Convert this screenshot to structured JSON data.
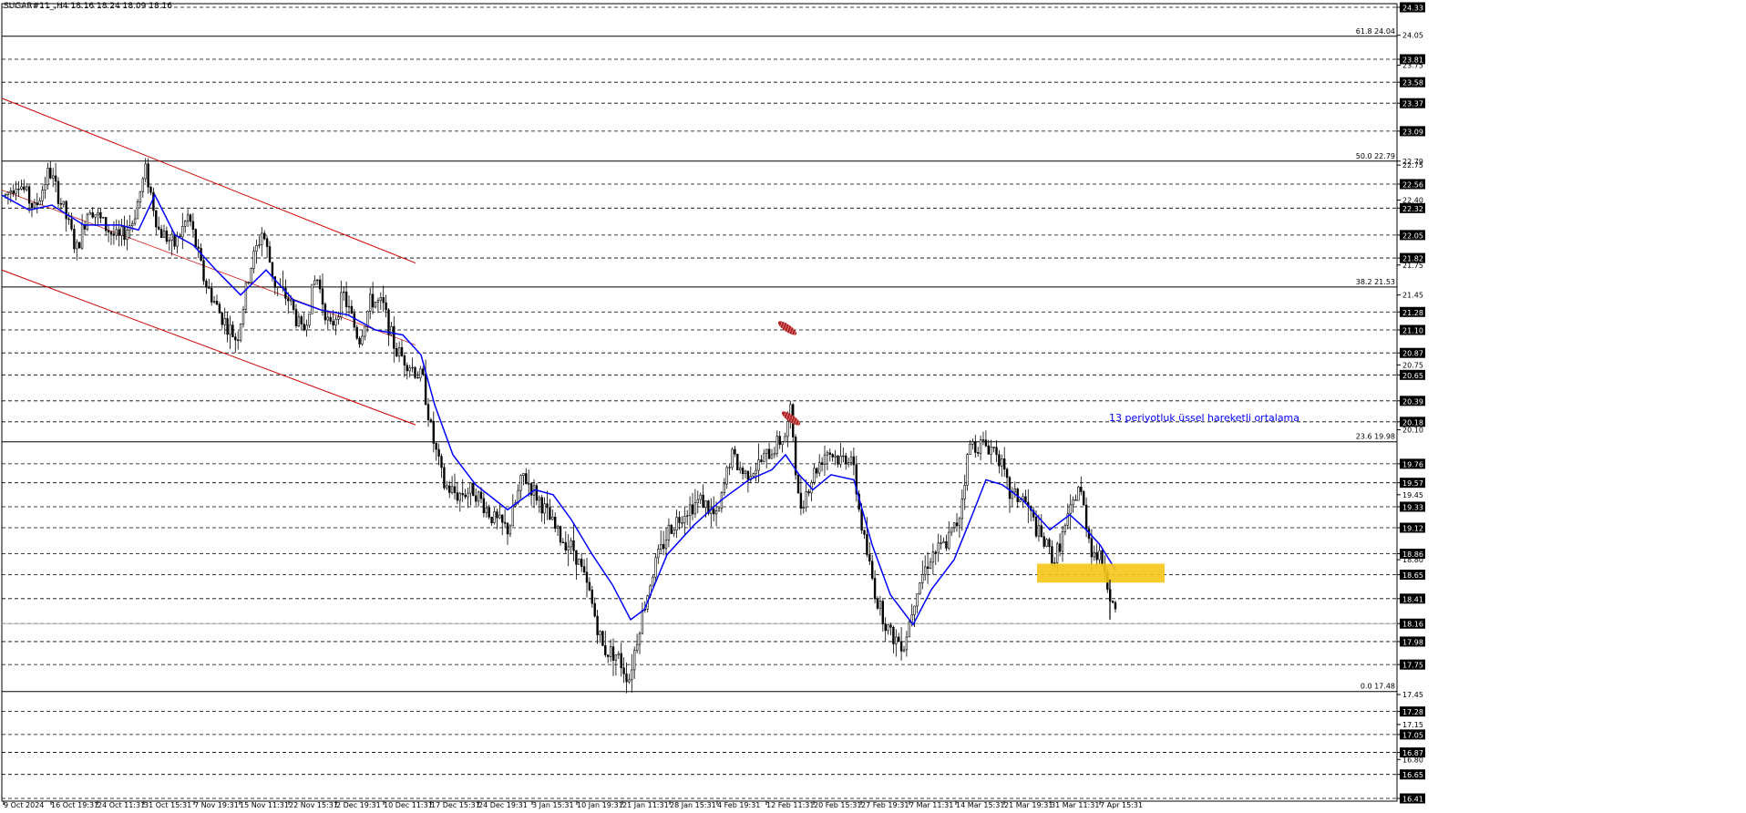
{
  "header": {
    "title": "SUGAR#11_,H4  18.16 18.24 18.09 18.16"
  },
  "colors": {
    "background": "#ffffff",
    "axis": "#000000",
    "candle": "#000000",
    "grid": "#000000",
    "ema": "#0000ff",
    "channel": "#cc0000",
    "highlight": "#f5c518",
    "marker": "#b22222",
    "price_tag_bg": "#000000",
    "price_tag_text": "#ffffff",
    "annotation": "#0000ff"
  },
  "chart_data": {
    "type": "candlestick",
    "symbol": "SUGAR#11_",
    "timeframe": "H4",
    "ylim": [
      16.41,
      24.33
    ],
    "y_axis_ticks": [
      "24.33",
      "24.05",
      "23.81",
      "23.75",
      "23.58",
      "23.37",
      "23.09",
      "22.79",
      "22.75",
      "22.56",
      "22.40",
      "22.32",
      "22.05",
      "21.82",
      "21.75",
      "21.45",
      "21.28",
      "21.10",
      "20.87",
      "20.75",
      "20.65",
      "20.39",
      "20.18",
      "20.10",
      "19.76",
      "19.57",
      "19.45",
      "19.33",
      "19.12",
      "18.86",
      "18.80",
      "18.65",
      "18.41",
      "18.16",
      "17.98",
      "17.75",
      "17.45",
      "17.28",
      "17.15",
      "17.05",
      "16.87",
      "16.80",
      "16.65",
      "16.41"
    ],
    "x_axis_labels": [
      "9 Oct 2024",
      "16 Oct 19:31",
      "24 Oct 11:31",
      "31 Oct 15:31",
      "7 Nov 19:31",
      "15 Nov 11:31",
      "22 Nov 15:31",
      "2 Dec 19:31",
      "10 Dec 11:31",
      "17 Dec 15:31",
      "24 Dec 19:31",
      "3 Jan 15:31",
      "10 Jan 19:31",
      "21 Jan 11:31",
      "28 Jan 15:31",
      "4 Feb 19:31",
      "12 Feb 11:31",
      "20 Feb 15:31",
      "27 Feb 19:31",
      "7 Mar 11:31",
      "14 Mar 15:31",
      "21 Mar 19:31",
      "31 Mar 11:31",
      "7 Apr 15:31"
    ],
    "price_tags": [
      "24.33",
      "23.81",
      "23.58",
      "23.37",
      "23.09",
      "22.56",
      "22.32",
      "22.05",
      "21.82",
      "21.28",
      "21.10",
      "20.87",
      "20.65",
      "20.39",
      "20.18",
      "19.76",
      "19.57",
      "19.33",
      "19.12",
      "18.86",
      "18.65",
      "18.41",
      "18.16",
      "17.98",
      "17.75",
      "17.28",
      "17.05",
      "16.87",
      "16.65",
      "16.41"
    ],
    "fibonacci": [
      {
        "label": "61.8 24.04",
        "value": 24.04
      },
      {
        "label": "50.0 22.79",
        "value": 22.79
      },
      {
        "label": "38.2 21.53",
        "value": 21.53
      },
      {
        "label": "23.6 19.98",
        "value": 19.98
      },
      {
        "label": "0.0 17.48",
        "value": 17.48
      }
    ],
    "current_price": 18.16,
    "ohlc": {
      "open": 18.16,
      "high": 18.24,
      "low": 18.09,
      "close": 18.16
    },
    "ema_annotation": "13 periyotluk üssel hareketli ortalama",
    "path": [
      [
        0,
        22.4
      ],
      [
        18,
        22.6
      ],
      [
        36,
        22.3
      ],
      [
        52,
        22.7
      ],
      [
        68,
        22.3
      ],
      [
        82,
        21.9
      ],
      [
        96,
        22.35
      ],
      [
        112,
        22.15
      ],
      [
        128,
        22.0
      ],
      [
        144,
        22.2
      ],
      [
        158,
        22.7
      ],
      [
        172,
        22.1
      ],
      [
        190,
        21.95
      ],
      [
        205,
        22.25
      ],
      [
        222,
        21.6
      ],
      [
        240,
        21.25
      ],
      [
        258,
        21.0
      ],
      [
        272,
        21.7
      ],
      [
        286,
        22.1
      ],
      [
        300,
        21.55
      ],
      [
        315,
        21.4
      ],
      [
        330,
        21.05
      ],
      [
        345,
        21.65
      ],
      [
        360,
        21.1
      ],
      [
        375,
        21.45
      ],
      [
        392,
        21.0
      ],
      [
        405,
        21.4
      ],
      [
        418,
        21.35
      ],
      [
        432,
        20.9
      ],
      [
        448,
        20.75
      ],
      [
        462,
        20.6
      ],
      [
        472,
        20.05
      ],
      [
        485,
        19.55
      ],
      [
        500,
        19.45
      ],
      [
        518,
        19.5
      ],
      [
        540,
        19.2
      ],
      [
        556,
        19.1
      ],
      [
        572,
        19.65
      ],
      [
        590,
        19.4
      ],
      [
        610,
        19.05
      ],
      [
        628,
        18.9
      ],
      [
        645,
        18.45
      ],
      [
        660,
        17.9
      ],
      [
        675,
        17.85
      ],
      [
        688,
        17.6
      ],
      [
        700,
        18.15
      ],
      [
        715,
        18.7
      ],
      [
        732,
        19.1
      ],
      [
        750,
        19.3
      ],
      [
        768,
        19.4
      ],
      [
        785,
        19.2
      ],
      [
        800,
        19.85
      ],
      [
        815,
        19.65
      ],
      [
        830,
        19.75
      ],
      [
        845,
        19.9
      ],
      [
        860,
        20.05
      ],
      [
        866,
        20.3
      ],
      [
        875,
        19.3
      ],
      [
        890,
        19.65
      ],
      [
        905,
        19.9
      ],
      [
        920,
        19.8
      ],
      [
        932,
        19.85
      ],
      [
        945,
        19.05
      ],
      [
        960,
        18.4
      ],
      [
        975,
        18.05
      ],
      [
        990,
        17.95
      ],
      [
        1005,
        18.55
      ],
      [
        1020,
        18.85
      ],
      [
        1035,
        18.95
      ],
      [
        1050,
        19.2
      ],
      [
        1062,
        19.95
      ],
      [
        1078,
        19.95
      ],
      [
        1092,
        19.9
      ],
      [
        1106,
        19.45
      ],
      [
        1122,
        19.4
      ],
      [
        1138,
        19.05
      ],
      [
        1155,
        18.8
      ],
      [
        1170,
        19.2
      ],
      [
        1182,
        19.55
      ],
      [
        1196,
        18.9
      ],
      [
        1210,
        18.75
      ],
      [
        1216,
        18.45
      ],
      [
        1224,
        18.15
      ]
    ],
    "ema": [
      [
        0,
        22.45
      ],
      [
        30,
        22.3
      ],
      [
        55,
        22.35
      ],
      [
        90,
        22.15
      ],
      [
        130,
        22.15
      ],
      [
        150,
        22.1
      ],
      [
        168,
        22.45
      ],
      [
        190,
        22.05
      ],
      [
        210,
        21.95
      ],
      [
        235,
        21.7
      ],
      [
        262,
        21.45
      ],
      [
        290,
        21.7
      ],
      [
        320,
        21.4
      ],
      [
        350,
        21.3
      ],
      [
        380,
        21.25
      ],
      [
        410,
        21.1
      ],
      [
        440,
        21.05
      ],
      [
        460,
        20.85
      ],
      [
        475,
        20.35
      ],
      [
        495,
        19.85
      ],
      [
        520,
        19.55
      ],
      [
        555,
        19.3
      ],
      [
        585,
        19.5
      ],
      [
        605,
        19.45
      ],
      [
        625,
        19.2
      ],
      [
        648,
        18.85
      ],
      [
        670,
        18.55
      ],
      [
        690,
        18.2
      ],
      [
        705,
        18.3
      ],
      [
        730,
        18.85
      ],
      [
        760,
        19.15
      ],
      [
        790,
        19.4
      ],
      [
        820,
        19.6
      ],
      [
        845,
        19.7
      ],
      [
        860,
        19.85
      ],
      [
        875,
        19.65
      ],
      [
        890,
        19.5
      ],
      [
        910,
        19.65
      ],
      [
        935,
        19.6
      ],
      [
        955,
        18.95
      ],
      [
        975,
        18.45
      ],
      [
        1000,
        18.15
      ],
      [
        1020,
        18.5
      ],
      [
        1045,
        18.8
      ],
      [
        1065,
        19.25
      ],
      [
        1080,
        19.6
      ],
      [
        1098,
        19.55
      ],
      [
        1120,
        19.4
      ],
      [
        1150,
        19.1
      ],
      [
        1172,
        19.25
      ],
      [
        1190,
        19.1
      ],
      [
        1205,
        18.95
      ],
      [
        1222,
        18.7
      ]
    ]
  }
}
